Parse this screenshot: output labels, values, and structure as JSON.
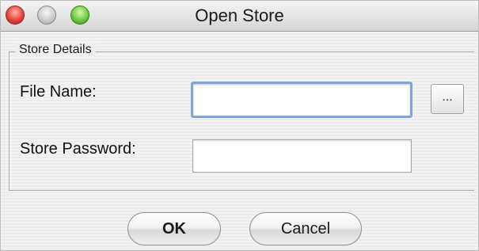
{
  "window": {
    "title": "Open Store"
  },
  "store_details": {
    "legend": "Store Details",
    "file_name": {
      "label": "File Name:",
      "value": "",
      "placeholder": ""
    },
    "browse_label": "...",
    "store_password": {
      "label": "Store Password:",
      "value": "",
      "placeholder": ""
    }
  },
  "buttons": {
    "ok_label": "OK",
    "cancel_label": "Cancel"
  },
  "colors": {
    "close": "#e8443b",
    "minimize": "#c9c9c9",
    "zoom": "#6ecb3f",
    "focus_ring": "#7fa6d9"
  },
  "icons": {
    "close": "close-icon",
    "minimize": "minimize-icon",
    "zoom": "zoom-icon"
  }
}
